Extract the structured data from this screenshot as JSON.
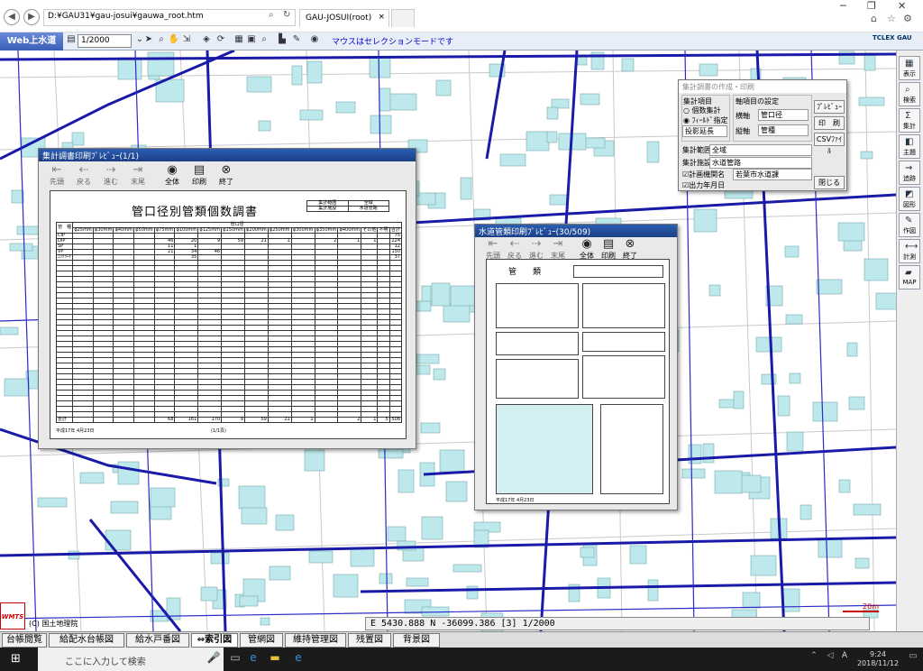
{
  "browser": {
    "address": "D:¥GAU31¥gau-josui¥gauwa_root.htm",
    "tab_title": "GAU-JOSUI(root)",
    "back_icon": "back-arrow-icon",
    "forward_icon": "forward-arrow-icon"
  },
  "app_toolbar": {
    "brand": "Web上水道",
    "scale_value": "1/2000",
    "message": "マウスはセレクションモードです",
    "logo": "TCLEX GAU"
  },
  "right_tools": [
    {
      "label": "表示",
      "icon": "display-icon"
    },
    {
      "label": "検索",
      "icon": "search-icon"
    },
    {
      "label": "集計",
      "icon": "sum-icon"
    },
    {
      "label": "主題",
      "icon": "theme-icon"
    },
    {
      "label": "追跡",
      "icon": "trace-icon"
    },
    {
      "label": "図形",
      "icon": "shape-icon"
    },
    {
      "label": "作図",
      "icon": "draw-icon"
    },
    {
      "label": "計測",
      "icon": "measure-icon"
    },
    {
      "label": "MAP",
      "icon": "folder-icon"
    }
  ],
  "status": {
    "coords": "E 5430.888 N -36099.386 [3] 1/2000",
    "copyright": "(C) 国土地理院",
    "wmts": "WMTS",
    "scale_bar": "20m"
  },
  "bottom_tabs": [
    "台帳閲覧",
    "給配水台帳図",
    "給水戸番図",
    "⇔索引図",
    "管網図",
    "維持管理図",
    "残置図",
    "背景図"
  ],
  "taskbar": {
    "search_placeholder": "ここに入力して検索",
    "time": "9:24",
    "date": "2018/11/12"
  },
  "preview1": {
    "title": "集計調書印刷ﾌﾟﾚﾋﾞｭｰ(1/1)",
    "buttons": [
      "先頭",
      "戻る",
      "進む",
      "末尾",
      "全体",
      "印刷",
      "終了"
    ],
    "doc_title": "管口径別管類個数調書",
    "meta": [
      [
        "集計範囲",
        "全域"
      ],
      [
        "集計施設",
        "水道管路"
      ]
    ],
    "header_group": "管口径",
    "col_headers": [
      "管　種",
      "φ25mm",
      "φ30mm",
      "φ40mm",
      "φ50mm",
      "φ75mm",
      "φ100mm",
      "φ125mm",
      "φ150mm",
      "φ200mm",
      "φ250mm",
      "φ300mm",
      "φ350mm",
      "φ400mm",
      "その他",
      "不明",
      "合計"
    ],
    "rows": [
      [
        "CIP",
        "",
        "",
        "",
        "",
        "",
        "",
        "",
        "",
        "",
        "",
        "",
        "",
        "",
        "",
        "",
        "75"
      ],
      [
        "DIP",
        "",
        "",
        "",
        "",
        "46",
        "20",
        "9",
        "59",
        "21",
        "1",
        "",
        "2",
        "1",
        "1",
        "",
        "224"
      ],
      [
        "SP",
        "",
        "",
        "",
        "",
        "11",
        "1",
        "",
        "",
        "",
        "",
        "",
        "",
        "",
        "",
        "",
        "12"
      ],
      [
        "VP",
        "",
        "",
        "",
        "",
        "21",
        "34",
        "46",
        "",
        "",
        "",
        "",
        "",
        "",
        "",
        "",
        "150"
      ],
      [
        "ｺﾝｸﾘｰﾄ",
        "",
        "",
        "",
        "",
        "",
        "35",
        "",
        "",
        "",
        "",
        "",
        "",
        "",
        "",
        "",
        "37"
      ]
    ],
    "total_row": [
      "合計",
      "",
      "",
      "",
      "",
      "68",
      "161",
      "170",
      "9",
      "59",
      "21",
      "1",
      "",
      "2",
      "1",
      "5",
      "508"
    ],
    "footer_date": "平成17年 4月23日",
    "footer_page": "(1/1頁)"
  },
  "aggregation_dialog": {
    "title": "集計調書の作成・印刷",
    "item_group": "集計項目",
    "radio1": "個数集計",
    "radio2": "ﾌｨｰﾙﾄﾞ指定",
    "field_select": "投影延長",
    "axis_group": "軸項目の設定",
    "axis_h_label": "横軸",
    "axis_h_value": "管口径",
    "axis_v_label": "縦軸",
    "axis_v_value": "管種",
    "buttons": [
      "ﾌﾟﾚﾋﾞｭｰ",
      "印　刷",
      "CSVﾌｧｲﾙ"
    ],
    "range_label": "集計範囲",
    "range_value": "全域",
    "facility_label": "集計施設",
    "facility_value": "水道管路",
    "check1": "計画機関名",
    "check1_value": "若葉市水道課",
    "check2": "出力年月日",
    "close": "閉じる"
  },
  "preview2": {
    "title": "水道管類印刷ﾌﾟﾚﾋﾞｭｰ(30/509)",
    "buttons": [
      "先頭",
      "戻る",
      "進む",
      "末尾",
      "全体",
      "印刷",
      "終了"
    ],
    "doc_title": "管　　類",
    "footer_date": "平成17年 4月23日"
  }
}
